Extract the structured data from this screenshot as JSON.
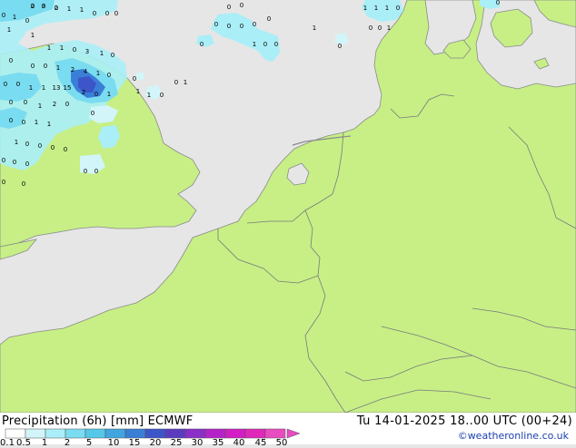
{
  "map": {
    "region": "North Sea / Western Europe",
    "colors": {
      "sea": "#e6e6e6",
      "land": "#c7ef86",
      "border": "#7a7a7a",
      "coast": "#8a8a8a"
    },
    "precip_values": [
      {
        "text": "2"
      },
      {
        "text": "3"
      },
      {
        "text": "2"
      },
      {
        "text": "1"
      },
      {
        "text": "1"
      },
      {
        "text": "0"
      },
      {
        "text": "0"
      },
      {
        "text": "0"
      },
      {
        "text": "1"
      },
      {
        "text": "0"
      },
      {
        "text": "0"
      },
      {
        "text": "0"
      },
      {
        "text": "0"
      },
      {
        "text": "0"
      },
      {
        "text": "0"
      },
      {
        "text": "0"
      },
      {
        "text": "0"
      },
      {
        "text": "1"
      },
      {
        "text": "0"
      },
      {
        "text": "0"
      },
      {
        "text": "1"
      },
      {
        "text": "1"
      },
      {
        "text": "1"
      },
      {
        "text": "1"
      },
      {
        "text": "0"
      },
      {
        "text": "0"
      },
      {
        "text": "0"
      },
      {
        "text": "1"
      },
      {
        "text": "0"
      },
      {
        "text": "1"
      },
      {
        "text": "1"
      },
      {
        "text": "1"
      },
      {
        "text": "1"
      },
      {
        "text": "0"
      },
      {
        "text": "3"
      },
      {
        "text": "1"
      },
      {
        "text": "0"
      },
      {
        "text": "0"
      },
      {
        "text": "0"
      },
      {
        "text": "0"
      },
      {
        "text": "1"
      },
      {
        "text": "2"
      },
      {
        "text": "4"
      },
      {
        "text": "1"
      },
      {
        "text": "0"
      },
      {
        "text": "0"
      },
      {
        "text": "0"
      },
      {
        "text": "1"
      },
      {
        "text": "1"
      },
      {
        "text": "13"
      },
      {
        "text": "15"
      },
      {
        "text": "2"
      },
      {
        "text": "0"
      },
      {
        "text": "1"
      },
      {
        "text": "0"
      },
      {
        "text": "0"
      },
      {
        "text": "1"
      },
      {
        "text": "2"
      },
      {
        "text": "0"
      },
      {
        "text": "0"
      },
      {
        "text": "0"
      },
      {
        "text": "1"
      },
      {
        "text": "0"
      },
      {
        "text": "0"
      },
      {
        "text": "1"
      },
      {
        "text": "1"
      },
      {
        "text": "0"
      },
      {
        "text": "0"
      },
      {
        "text": "1"
      },
      {
        "text": "1"
      },
      {
        "text": "1"
      },
      {
        "text": "0"
      },
      {
        "text": "0"
      },
      {
        "text": "0"
      },
      {
        "text": "0"
      },
      {
        "text": "0"
      },
      {
        "text": "0"
      },
      {
        "text": "0"
      },
      {
        "text": "0"
      },
      {
        "text": "0"
      },
      {
        "text": "0"
      },
      {
        "text": "0"
      },
      {
        "text": "0"
      },
      {
        "text": "0"
      },
      {
        "text": "0"
      },
      {
        "text": "0"
      },
      {
        "text": "0"
      },
      {
        "text": "0"
      }
    ]
  },
  "footer": {
    "title": "Precipitation (6h) [mm] ECMWF",
    "time": "Tu 14-01-2025 18..00 UTC (00+24)",
    "credit": "©weatheronline.co.uk",
    "legend_ticks": [
      "0.1",
      "0.5",
      "1",
      "2",
      "5",
      "10",
      "15",
      "20",
      "25",
      "30",
      "35",
      "40",
      "45",
      "50"
    ],
    "legend_colors": [
      "#ffffff",
      "#d2f5fa",
      "#aaeef7",
      "#7adcf0",
      "#55c8e8",
      "#41a5e0",
      "#3a7fd6",
      "#3c55c8",
      "#5b3cc0",
      "#8a2fc8",
      "#b523c8",
      "#d21ec4",
      "#e028b9",
      "#e84cc0"
    ]
  }
}
